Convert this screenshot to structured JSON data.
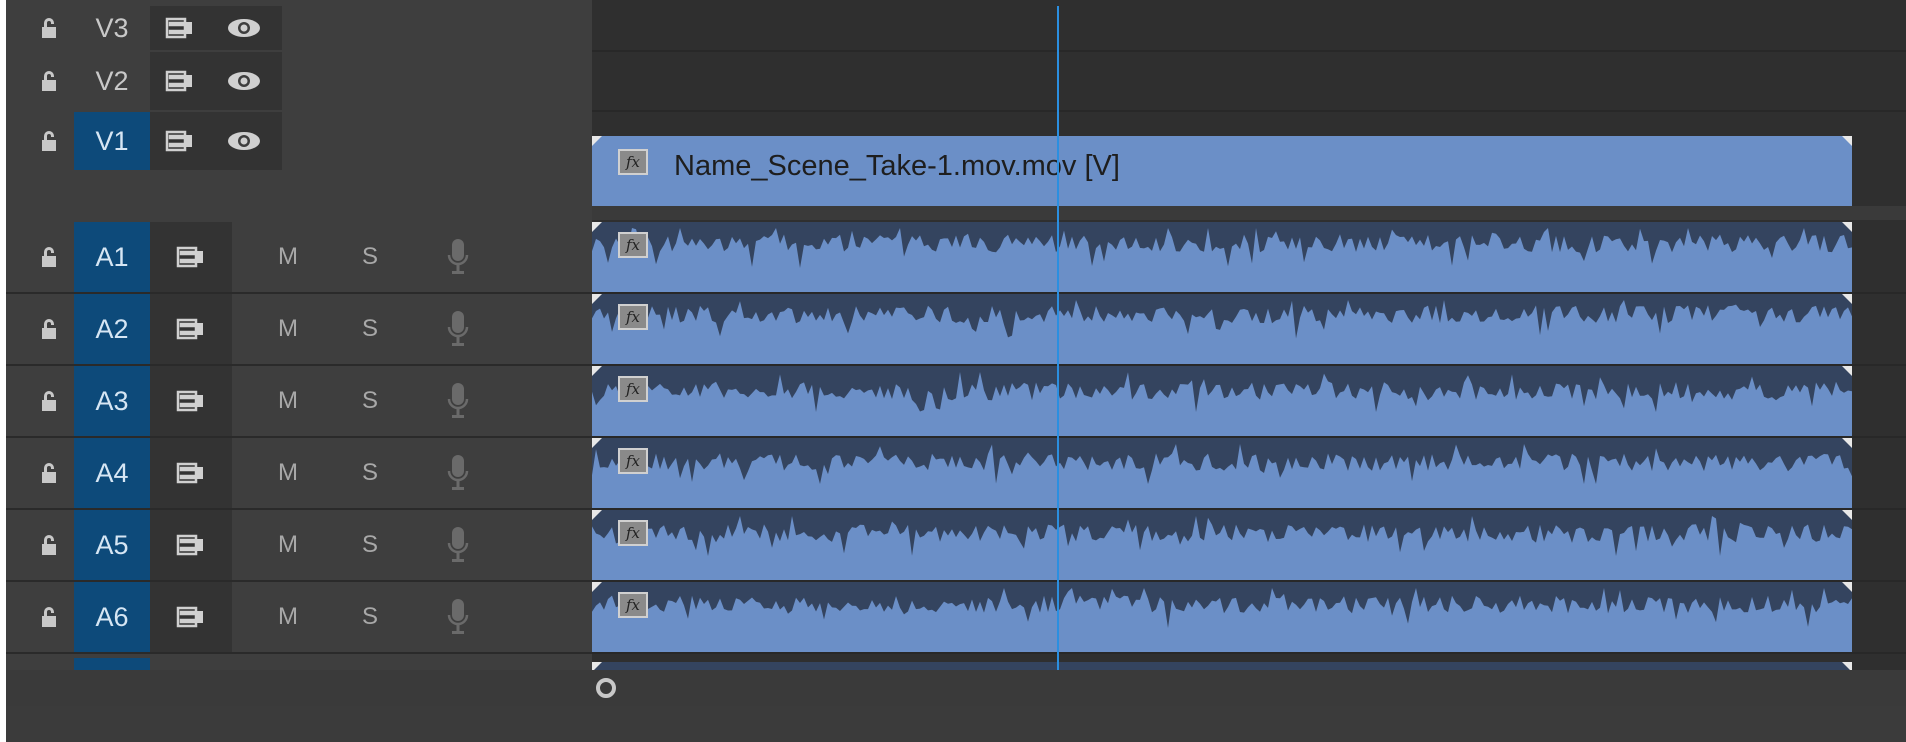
{
  "video_tracks": [
    {
      "label": "V3",
      "targeted": false
    },
    {
      "label": "V2",
      "targeted": false
    },
    {
      "label": "V1",
      "targeted": true
    }
  ],
  "audio_tracks": [
    {
      "label": "A1",
      "mute": "M",
      "solo": "S"
    },
    {
      "label": "A2",
      "mute": "M",
      "solo": "S"
    },
    {
      "label": "A3",
      "mute": "M",
      "solo": "S"
    },
    {
      "label": "A4",
      "mute": "M",
      "solo": "S"
    },
    {
      "label": "A5",
      "mute": "M",
      "solo": "S"
    },
    {
      "label": "A6",
      "mute": "M",
      "solo": "S"
    }
  ],
  "video_clip": {
    "name": "Name_Scene_Take-1.mov.mov [V]",
    "fx": "fx"
  },
  "audio_clip_fx": "fx",
  "icons": {
    "lock": "lock-icon",
    "sync": "sync-lock-icon",
    "eye": "eye-icon",
    "mic": "microphone-icon"
  },
  "colors": {
    "clip": "#6b8fc7",
    "waveform_bg": "#34445f",
    "target_active": "#0d4a7a",
    "playhead": "#2b8fe0"
  }
}
